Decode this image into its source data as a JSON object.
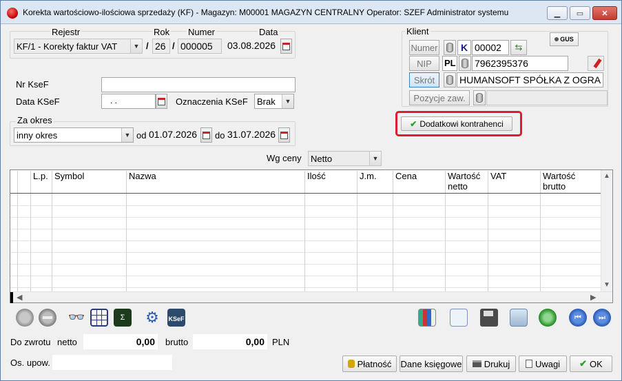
{
  "window": {
    "title": "Korekta wartościowo-ilościowa sprzedaży (KF) - Magazyn: M00001 MAGAZYN CENTRALNY  Operator: SZEF Administrator systemu"
  },
  "document": {
    "rejestr_label": "Rejestr",
    "rok_label": "Rok",
    "numer_label": "Numer",
    "data_label": "Data",
    "rejestr_value": "KF/1   - Korekty faktur VAT",
    "rok_value": "26",
    "numer_value": "000005",
    "data_value": "03.08.2026",
    "sep": "/"
  },
  "ksef": {
    "nr_label": "Nr KseF",
    "nr_value": "",
    "data_label": "Data KSeF",
    "data_value": ". .",
    "oznaczenia_label": "Oznaczenia KSeF",
    "oznaczenia_value": "Brak"
  },
  "period": {
    "label": "Za okres",
    "value": "inny okres",
    "od_label": "od",
    "od_value": "01.07.2026",
    "do_label": "do",
    "do_value": "31.07.2026"
  },
  "klient": {
    "label": "Klient",
    "numer_btn": "Numer",
    "numer_prefix": "K",
    "numer_value": "00002",
    "nip_btn": "NIP",
    "nip_prefix": "PL",
    "nip_value": "7962395376",
    "skrot_btn": "Skrót",
    "skrot_value": "HUMANSOFT SPÓŁKA Z OGRA",
    "pozycje_btn": "Pozycje zaw.",
    "pozycje_value": "",
    "gus_label": "GUS",
    "dodatkowi_btn": "Dodatkowi kontrahenci"
  },
  "wg_ceny": {
    "label": "Wg ceny",
    "value": "Netto"
  },
  "grid": {
    "columns": [
      "L.p.",
      "Symbol",
      "Nazwa",
      "Ilość",
      "J.m.",
      "Cena",
      "Wartość netto",
      "VAT",
      "Wartość brutto"
    ],
    "rows": []
  },
  "totals": {
    "do_zwrotu_label": "Do zwrotu",
    "netto_label": "netto",
    "netto_value": "0,00",
    "brutto_label": "brutto",
    "brutto_value": "0,00",
    "currency": "PLN",
    "os_upow_label": "Os. upow.",
    "os_upow_value": ""
  },
  "buttons": {
    "platnosc": "Płatność",
    "dane_ksiegowe": "Dane księgowe",
    "drukuj": "Drukuj",
    "uwagi": "Uwagi",
    "ok": "OK"
  },
  "colors": {
    "highlight": "#d9202c",
    "title_bg": "#dde7f3",
    "ok_check": "#2aa02a"
  }
}
